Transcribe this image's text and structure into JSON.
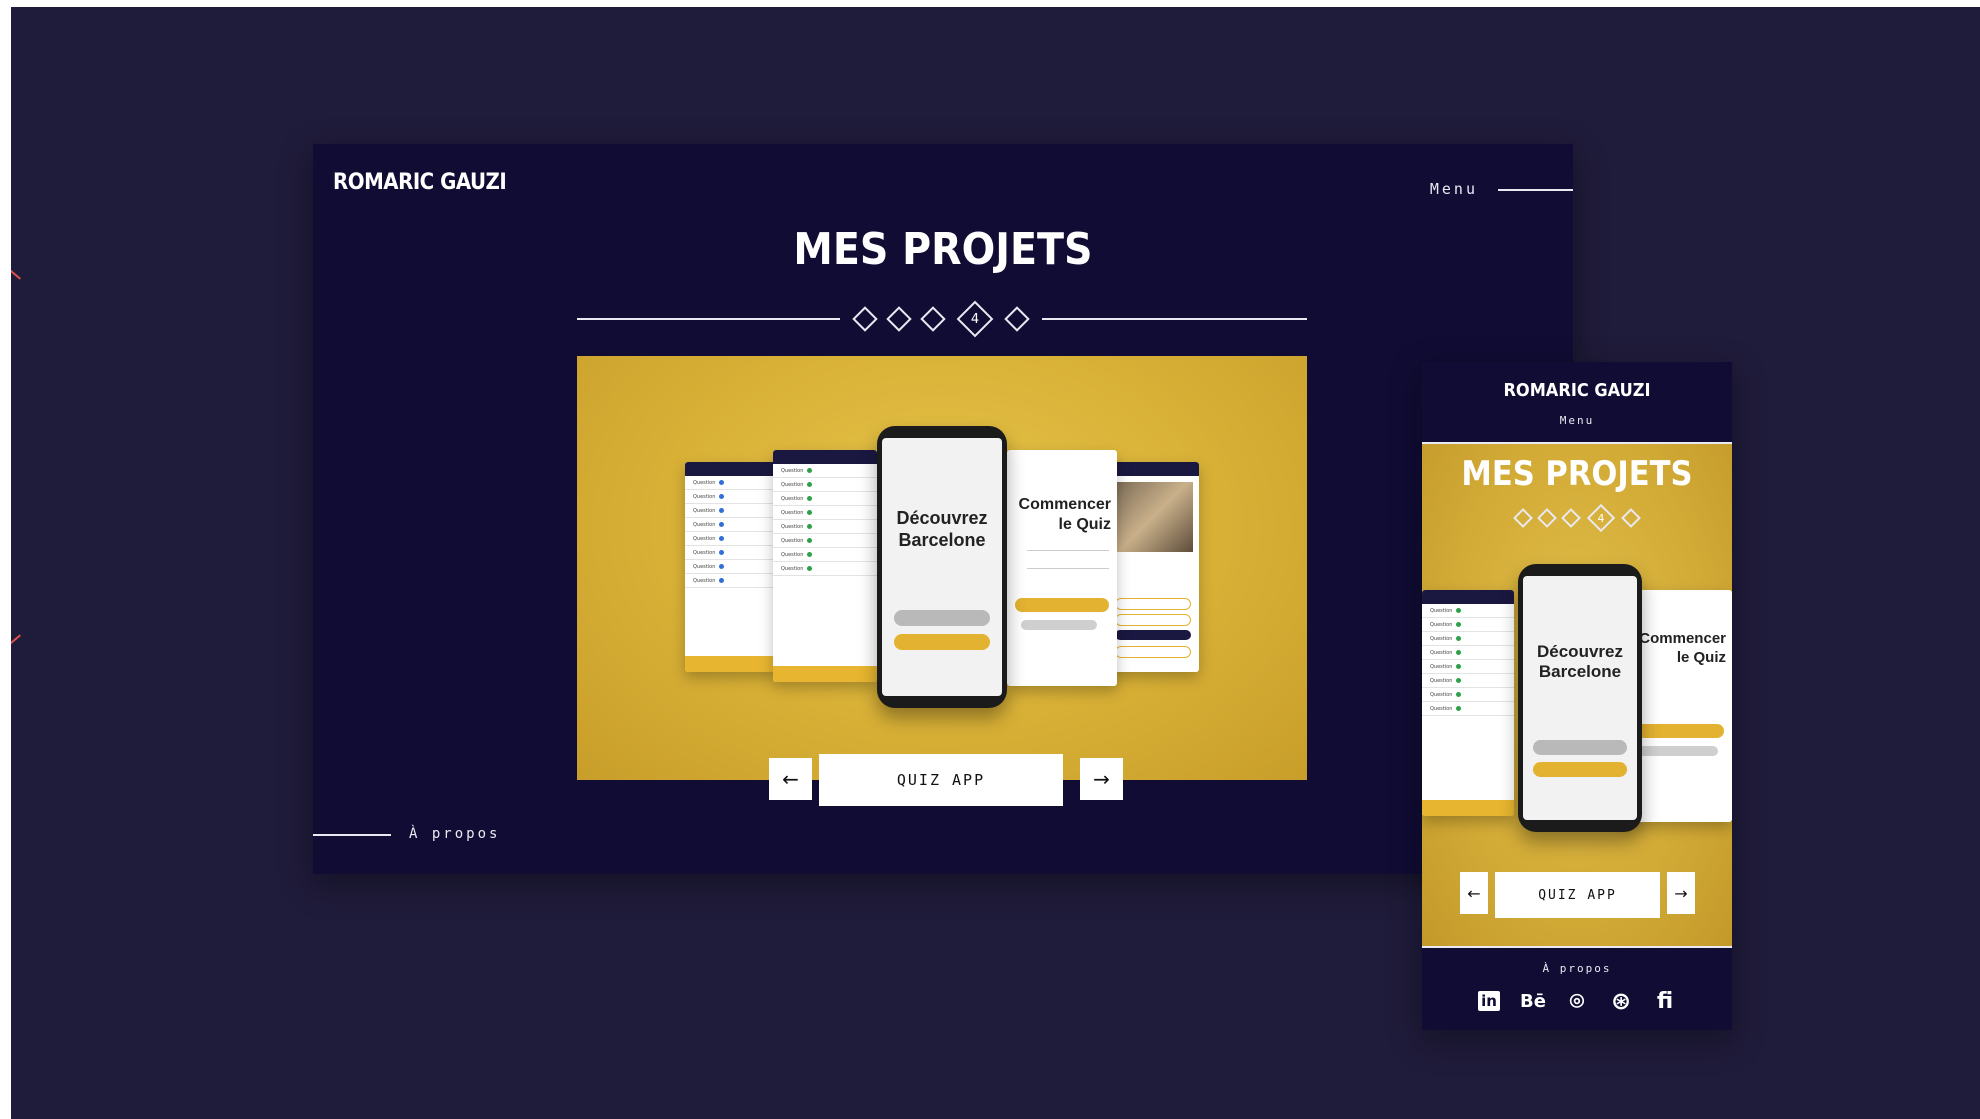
{
  "desktop": {
    "brand": "ROMARIC GAUZI",
    "menu_label": "Menu",
    "title": "MES PROJETS",
    "pager": {
      "active_number": "4",
      "count": 5,
      "active_index": 3
    },
    "project_label": "QUIZ APP",
    "prev_arrow": "←",
    "next_arrow": "→",
    "about_label": "À propos"
  },
  "mockup": {
    "phone_line1": "Découvrez",
    "phone_line2": "Barcelone",
    "quiz_line1": "Commencer",
    "quiz_line2": "le Quiz"
  },
  "mobile": {
    "brand": "ROMARIC GAUZI",
    "menu_label": "Menu",
    "title": "MES PROJETS",
    "pager_active_number": "4",
    "project_label": "QUIZ APP",
    "prev_arrow": "←",
    "next_arrow": "→",
    "about_label": "À propos",
    "socials": [
      {
        "icon": "linkedin-icon",
        "glyph": "in"
      },
      {
        "icon": "behance-icon",
        "glyph": "Bē"
      },
      {
        "icon": "github-icon",
        "glyph": "⌾"
      },
      {
        "icon": "dribbble-icon",
        "glyph": "⊛"
      },
      {
        "icon": "fiverr-icon",
        "glyph": "fi"
      }
    ]
  },
  "colors": {
    "background": "#1f1b3a",
    "panel": "#100c33",
    "hero_yellow": "#d8b036",
    "accent_line": "#e0504a"
  }
}
